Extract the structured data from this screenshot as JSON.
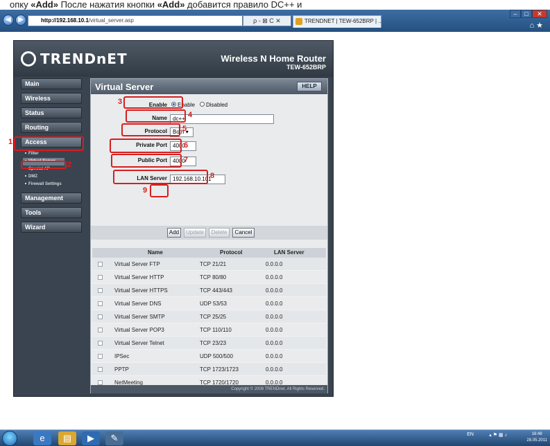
{
  "caption": {
    "prefix": "опку ",
    "quoted_button": "«Add»",
    "middle": " После нажатия кнопки ",
    "quoted_button2": "«Add»",
    "suffix": " добавится правило DC++ и"
  },
  "browser": {
    "url_host": "http://192.168.10.1",
    "url_path": "/virtual_server.asp",
    "addr_tools": "ρ - ⊠ C ✕",
    "tab_label": "TRENDNET | TEW-652BRP | ... ✕",
    "win_min": "–",
    "win_max": "□",
    "win_close": "✕",
    "home_star": "⌂ ★"
  },
  "router": {
    "brand": "TRENDnET",
    "product_title": "Wireless N Home Router",
    "product_model": "TEW-652BRP",
    "menu": [
      {
        "label": "Main"
      },
      {
        "label": "Wireless"
      },
      {
        "label": "Status"
      },
      {
        "label": "Routing"
      },
      {
        "label": "Access"
      },
      {
        "label": "Management"
      },
      {
        "label": "Tools"
      },
      {
        "label": "Wizard"
      }
    ],
    "submenu": [
      {
        "label": "Filter"
      },
      {
        "label": "Virtual Server"
      },
      {
        "label": "Special AP"
      },
      {
        "label": "DMZ"
      },
      {
        "label": "Firewall Settings"
      }
    ],
    "page_title": "Virtual Server",
    "help_label": "HELP",
    "form": {
      "enable_label": "Enable",
      "enable_opt": "Enable",
      "disabled_opt": "Disabled",
      "name_label": "Name",
      "name_value": "dc++",
      "protocol_label": "Protocol",
      "protocol_value": "Both",
      "private_port_label": "Private Port",
      "private_port_value": "4000",
      "public_port_label": "Public Port",
      "public_port_value": "4000",
      "lan_server_label": "LAN Server",
      "lan_server_value": "192.168.10.101"
    },
    "buttons": {
      "add": "Add",
      "update": "Update",
      "delete": "Delete",
      "cancel": "Cancel"
    },
    "table": {
      "headers": [
        "Name",
        "Protocol",
        "LAN Server"
      ],
      "rows": [
        {
          "name": "Virtual Server FTP",
          "protocol": "TCP 21/21",
          "lan": "0.0.0.0"
        },
        {
          "name": "Virtual Server HTTP",
          "protocol": "TCP 80/80",
          "lan": "0.0.0.0"
        },
        {
          "name": "Virtual Server HTTPS",
          "protocol": "TCP 443/443",
          "lan": "0.0.0.0"
        },
        {
          "name": "Virtual Server DNS",
          "protocol": "UDP 53/53",
          "lan": "0.0.0.0"
        },
        {
          "name": "Virtual Server SMTP",
          "protocol": "TCP 25/25",
          "lan": "0.0.0.0"
        },
        {
          "name": "Virtual Server POP3",
          "protocol": "TCP 110/110",
          "lan": "0.0.0.0"
        },
        {
          "name": "Virtual Server Telnet",
          "protocol": "TCP 23/23",
          "lan": "0.0.0.0"
        },
        {
          "name": "IPSec",
          "protocol": "UDP 500/500",
          "lan": "0.0.0.0"
        },
        {
          "name": "PPTP",
          "protocol": "TCP 1723/1723",
          "lan": "0.0.0.0"
        },
        {
          "name": "NetMeeting",
          "protocol": "TCP 1720/1720",
          "lan": "0.0.0.0"
        }
      ]
    },
    "copyright": "Copyright © 2008 TRENDnet. All Rights Reserved."
  },
  "annotations": {
    "n1": "1",
    "n2": "2",
    "n3": "3",
    "n4": "4",
    "n5": "5",
    "n6": "6",
    "n7": "7",
    "n8": "8",
    "n9": "9"
  },
  "taskbar": {
    "lang": "EN",
    "time": "16:48",
    "date": "28.05.2011"
  },
  "colors": {
    "annotation_red": "#d61e1e",
    "router_bg": "#3a4450",
    "panel_bg": "#e9ebed"
  }
}
